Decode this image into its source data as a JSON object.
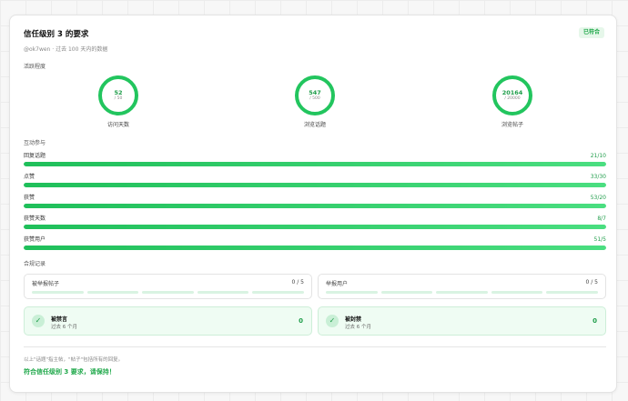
{
  "header": {
    "title": "信任级别 3 的要求",
    "subtitle": "@ok7wen · 过去 100 天内的数据",
    "badge": "已符合"
  },
  "sections": {
    "activity": "活跃程度",
    "engagement": "互动参与",
    "compliance": "合规记录"
  },
  "rings": [
    {
      "value": "52",
      "required": "/ 50",
      "label": "访问天数",
      "fraction": 1.0
    },
    {
      "value": "547",
      "required": "/ 500",
      "label": "浏览话题",
      "fraction": 1.0
    },
    {
      "value": "20164",
      "required": "/ 20000",
      "label": "浏览帖子",
      "fraction": 1.0
    }
  ],
  "bars": [
    {
      "label": "回复话题",
      "value": "21/10",
      "fraction": 1.0
    },
    {
      "label": "点赞",
      "value": "33/30",
      "fraction": 1.0
    },
    {
      "label": "获赞",
      "value": "53/20",
      "fraction": 1.0
    },
    {
      "label": "获赞天数",
      "value": "8/7",
      "fraction": 1.0
    },
    {
      "label": "获赞用户",
      "value": "51/5",
      "fraction": 1.0
    }
  ],
  "reports": [
    {
      "label": "被举报帖子",
      "value": "0 / 5",
      "filled_segments": 0
    },
    {
      "label": "举报用户",
      "value": "0 / 5",
      "filled_segments": 0
    }
  ],
  "penalties": [
    {
      "label": "被禁言",
      "period": "过去 6 个月",
      "value": "0"
    },
    {
      "label": "被封禁",
      "period": "过去 6 个月",
      "value": "0"
    }
  ],
  "footer": {
    "note": "以上\"话题\"指主帖，\"帖子\"包括所有的回复。",
    "status": "符合信任级别 3 要求，请保持！"
  },
  "colors": {
    "accent": "#22c55e",
    "accent_text": "#1f9d4a",
    "badge_bg": "#e6f7ea"
  }
}
